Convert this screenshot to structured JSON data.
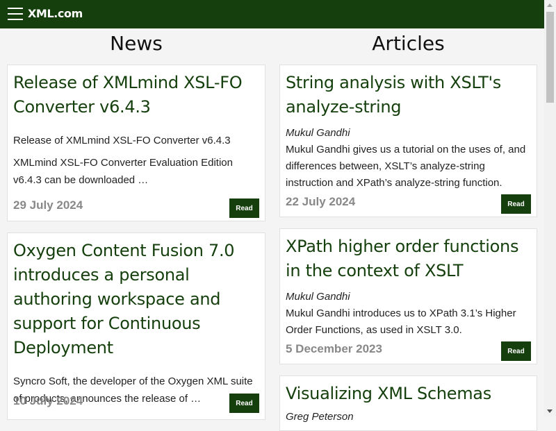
{
  "header": {
    "logo": "XML.com",
    "menu_icon": "hamburger-menu-icon"
  },
  "news": {
    "title": "News",
    "items": [
      {
        "title": "Release of XMLmind XSL-FO Converter v6.4.3",
        "subtitle": "Release of XMLmind XSL-FO Converter v6.4.3",
        "summary": "XMLmind XSL-FO Converter Evaluation Edition v6.4.3 can be downloaded …",
        "date": "29 July 2024",
        "read_label": "Read"
      },
      {
        "title": "Oxygen Content Fusion 7.0 introduces a personal authoring workspace and support for Continuous Deployment",
        "summary": "Syncro Soft, the developer of the Oxygen XML suite of products, announces the release of …",
        "date": "10 July 2024",
        "read_label": "Read"
      }
    ]
  },
  "articles": {
    "title": "Articles",
    "items": [
      {
        "title": "String analysis with XSLT's analyze-string",
        "author": "Mukul Gandhi",
        "summary": "Mukul Gandhi gives us a tutorial on the uses of, and differences between, XSLT’s analyze-string instruction and XPath’s analyze-string function.",
        "date": "22 July 2024",
        "read_label": "Read"
      },
      {
        "title": "XPath higher order functions in the context of XSLT",
        "author": "Mukul Gandhi",
        "summary": "Mukul Gandhi introduces us to XPath 3.1’s Higher Order Functions, as used in XSLT 3.0.",
        "date": "5 December 2023",
        "read_label": "Read"
      },
      {
        "title": "Visualizing XML Schemas",
        "author": "Greg Peterson"
      }
    ]
  },
  "colors": {
    "brand": "#15400d",
    "date_gray": "#888888",
    "background": "#f4f4f4"
  }
}
